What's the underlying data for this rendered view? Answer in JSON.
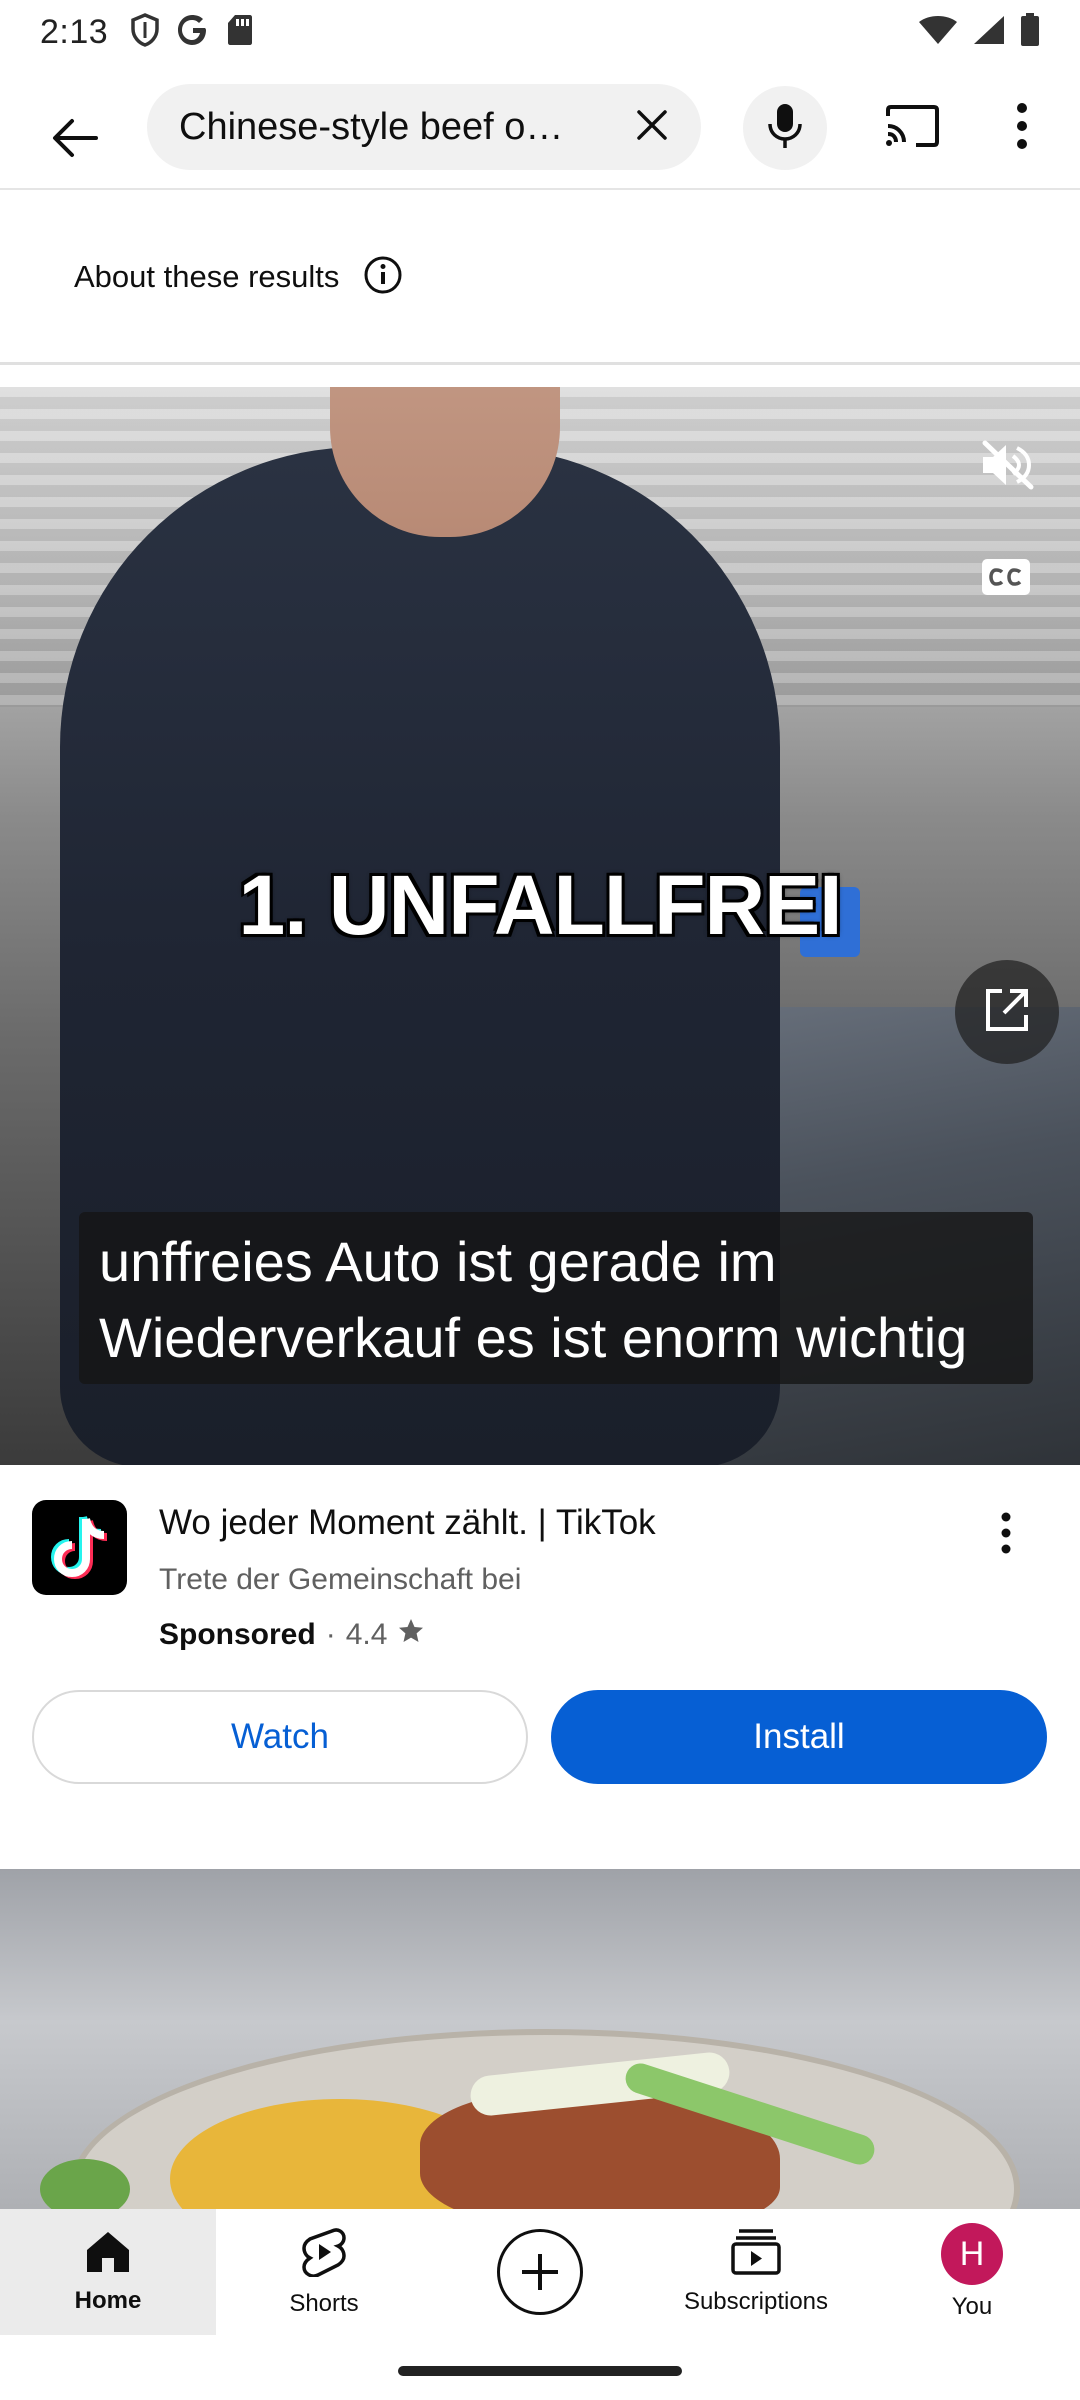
{
  "status_bar": {
    "time": "2:13",
    "icons": [
      "shield-icon",
      "google-icon",
      "sd-card-icon",
      "wifi-icon",
      "signal-icon",
      "battery-icon"
    ]
  },
  "search": {
    "query": "Chinese-style beef o…",
    "icons": {
      "back": "arrow-left-icon",
      "clear": "close-icon",
      "mic": "mic-icon",
      "cast": "cast-icon",
      "more": "more-vert-icon"
    }
  },
  "about": {
    "label": "About these results",
    "icon": "info-icon"
  },
  "video_ad": {
    "overlay_title": "1. UNFALLFREI",
    "caption_lines": [
      "unffreies Auto ist gerade im",
      "Wiederverkauf es ist enorm wichtig"
    ],
    "icons": {
      "mute": "volume-off-icon",
      "captions": "cc-icon",
      "open": "open-external-icon"
    }
  },
  "ad_info": {
    "title": "Wo jeder Moment zählt. | TikTok",
    "subtitle": "Trete der Gemeinschaft bei",
    "sponsored": "Sponsored",
    "separator": "·",
    "rating": "4.4",
    "watch_label": "Watch",
    "install_label": "Install",
    "colors": {
      "accent": "#065fd4"
    }
  },
  "bottom_nav": {
    "items": [
      {
        "label": "Home",
        "icon": "home-icon",
        "active": true
      },
      {
        "label": "Shorts",
        "icon": "shorts-icon",
        "active": false
      },
      {
        "label": "",
        "icon": "create-plus-icon",
        "active": false
      },
      {
        "label": "Subscriptions",
        "icon": "subscriptions-icon",
        "active": false
      },
      {
        "label": "You",
        "icon": "avatar",
        "active": false
      }
    ],
    "avatar_letter": "H",
    "avatar_color": "#c2185b"
  }
}
